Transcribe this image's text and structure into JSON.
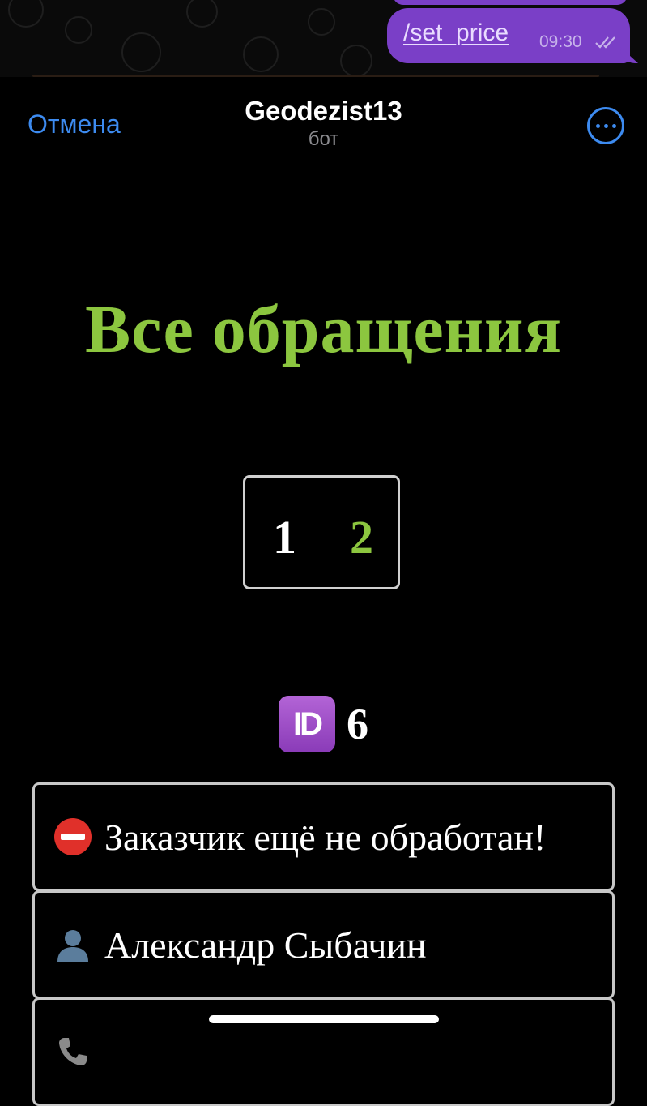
{
  "chat": {
    "message_text": "/set_price",
    "message_time": "09:30"
  },
  "header": {
    "cancel_label": "Отмена",
    "title": "Geodezist13",
    "subtitle": "бот"
  },
  "content": {
    "title": "Все обращения",
    "pagination": {
      "pages": [
        "1",
        "2"
      ],
      "active_page": "2"
    },
    "request": {
      "id_icon_text": "ID",
      "id_value": "6",
      "status_text": "Заказчик ещё не обработан!",
      "customer_name": "Александр Сыбачин"
    }
  },
  "colors": {
    "accent_green": "#8cc63f",
    "link_blue": "#3d8bf0",
    "bubble_purple": "#7a3fc7",
    "status_red": "#e0302a"
  },
  "icons": {
    "status": "no-entry-icon",
    "customer": "bust-silhouette-icon",
    "phone": "phone-icon",
    "more": "more-dots-icon",
    "read_receipt": "double-check-icon"
  }
}
